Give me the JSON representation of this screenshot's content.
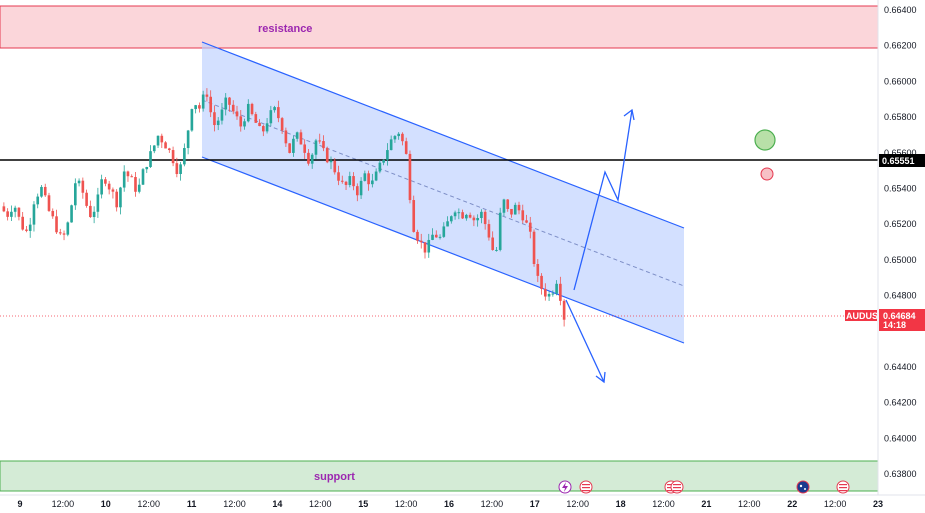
{
  "instrument": {
    "symbol": "AUDUSD",
    "last_price": "0.64684",
    "countdown": "14:18",
    "colors": {
      "up": "#26a69a",
      "down": "#ef5350",
      "channel": "#2962ff",
      "channel_fill": "#bbd0ff",
      "line": "#000000",
      "tag": "#f23645"
    }
  },
  "annotations": {
    "resistance_label": "resistance",
    "support_label": "support",
    "horizontal_level": "0.65551"
  },
  "markers": {
    "calendar_icons": [
      "lightning-event-icon",
      "us-flag-icon",
      "us-flag-icon",
      "us-flag-icon",
      "au-flag-icon",
      "us-flag-icon"
    ],
    "green_circle": "target-circle",
    "red_circle": "signal-circle"
  },
  "chart_data": {
    "type": "candlestick",
    "title": "",
    "ylim": [
      0.637,
      0.664
    ],
    "y_ticks": [
      "0.66400",
      "0.66200",
      "0.66000",
      "0.65800",
      "0.65600",
      "0.65400",
      "0.65200",
      "0.65000",
      "0.64800",
      "0.64400",
      "0.64200",
      "0.64000",
      "0.63800"
    ],
    "x_ticks": [
      "9",
      "12:00",
      "10",
      "12:00",
      "11",
      "12:00",
      "14",
      "12:00",
      "15",
      "12:00",
      "16",
      "12:00",
      "17",
      "12:00",
      "18",
      "12:00",
      "21",
      "12:00",
      "22",
      "12:00",
      "23"
    ],
    "resistance_zone": [
      0.6618,
      0.6641
    ],
    "support_zone": [
      0.6372,
      0.6388
    ],
    "key_level": 0.65551,
    "last_price": 0.64684,
    "channel": {
      "upper": [
        0.6622,
        0.6518
      ],
      "lower": [
        0.6558,
        0.6454
      ],
      "mid": [
        0.659,
        0.6486
      ]
    },
    "candles_path": [
      0.653,
      0.6525,
      0.6532,
      0.652,
      0.6515,
      0.6535,
      0.654,
      0.6528,
      0.652,
      0.651,
      0.6522,
      0.6545,
      0.6538,
      0.6525,
      0.653,
      0.6548,
      0.654,
      0.6532,
      0.655,
      0.6545,
      0.6538,
      0.6552,
      0.656,
      0.657,
      0.6565,
      0.6558,
      0.6548,
      0.6565,
      0.659,
      0.6585,
      0.6595,
      0.6575,
      0.658,
      0.659,
      0.6582,
      0.6575,
      0.6585,
      0.6578,
      0.657,
      0.658,
      0.6584,
      0.6575,
      0.656,
      0.657,
      0.6565,
      0.6555,
      0.6568,
      0.656,
      0.6555,
      0.6548,
      0.654,
      0.6545,
      0.6538,
      0.6548,
      0.6542,
      0.655,
      0.656,
      0.6568,
      0.6572,
      0.656,
      0.652,
      0.651,
      0.6505,
      0.6515,
      0.6512,
      0.652,
      0.653,
      0.6525,
      0.6528,
      0.6522,
      0.6526,
      0.6515,
      0.65,
      0.6535,
      0.6525,
      0.653,
      0.6525,
      0.6515,
      0.649,
      0.6482,
      0.648,
      0.649,
      0.6468
    ]
  }
}
